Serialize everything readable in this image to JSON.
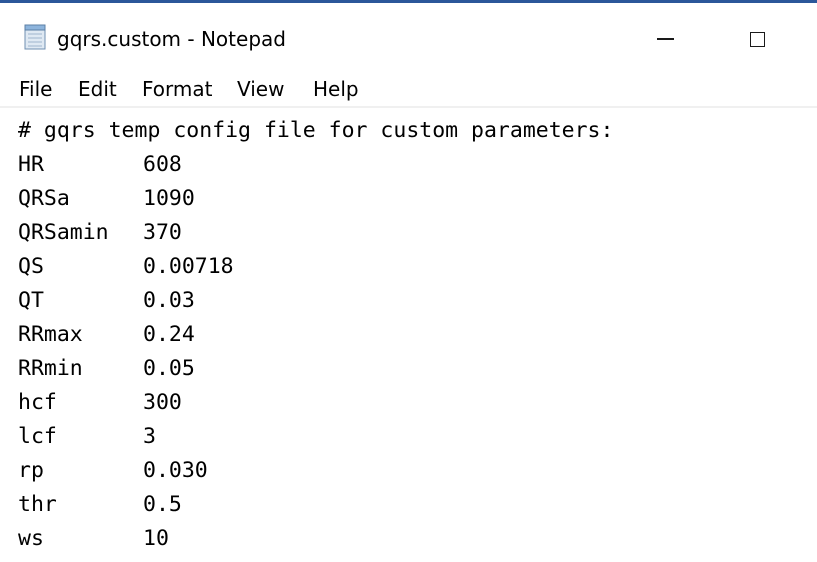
{
  "window": {
    "title": "gqrs.custom - Notepad",
    "icon": "notepad-icon",
    "accent_color": "#2b579a"
  },
  "menu": {
    "items": [
      "File",
      "Edit",
      "Format",
      "View",
      "Help"
    ]
  },
  "editor": {
    "header": "# gqrs temp config file for custom parameters:",
    "params": [
      {
        "key": "HR",
        "value": "608"
      },
      {
        "key": "QRSa",
        "value": "1090"
      },
      {
        "key": "QRSamin",
        "value": "370"
      },
      {
        "key": "QS",
        "value": "0.00718"
      },
      {
        "key": "QT",
        "value": "0.03"
      },
      {
        "key": "RRmax",
        "value": "0.24"
      },
      {
        "key": "RRmin",
        "value": "0.05"
      },
      {
        "key": "hcf",
        "value": "300"
      },
      {
        "key": "lcf",
        "value": "3"
      },
      {
        "key": "rp",
        "value": "0.030"
      },
      {
        "key": "thr",
        "value": "0.5"
      },
      {
        "key": "ws",
        "value": "10"
      }
    ]
  }
}
